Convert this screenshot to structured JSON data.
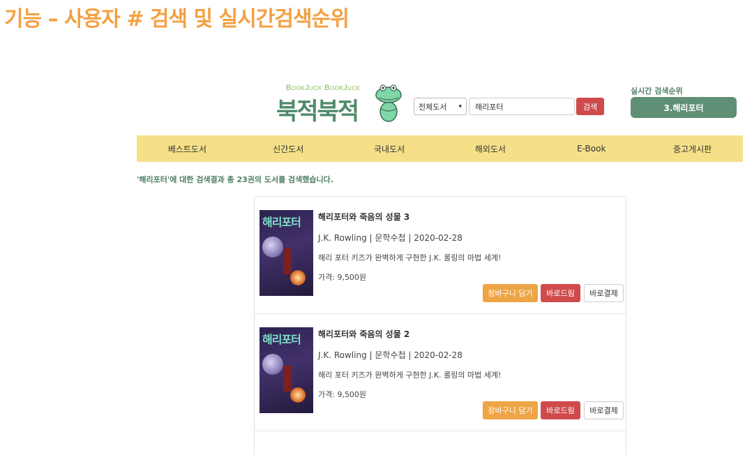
{
  "slide": {
    "title": "기능 – 사용자 # 검색 및 실시간검색순위"
  },
  "header": {
    "logo_sub": "BookJuck BookJuck",
    "logo_main": "북적북적",
    "category_selected": "전체도서",
    "search_value": "해리포터",
    "search_button": "검색",
    "rank_label": "실시간 검색순위",
    "rank_current": "3.해리포터"
  },
  "nav": {
    "items": [
      "베스트도서",
      "신간도서",
      "국내도서",
      "해외도서",
      "E-Book",
      "중고게시판"
    ]
  },
  "result_summary": "'해리포터'에 대한 검색결과 총 23권의 도서를 검색했습니다.",
  "books": [
    {
      "title": "해리포터와 죽음의 성물 3",
      "meta": "J.K. Rowling | 문학수첩 | 2020-02-28",
      "desc": "해리 포터 키즈가 완벽하게 구현한 J.K. 롤링의 마법 세계!",
      "price": "가격: 9,500원",
      "cover_text": "해리포터",
      "btn_cart": "장바구니 담기",
      "btn_gift": "바로드림",
      "btn_buy": "바로결제"
    },
    {
      "title": "해리포터와 죽음의 성물 2",
      "meta": "J.K. Rowling | 문학수첩 | 2020-02-28",
      "desc": "해리 포터 키즈가 완벽하게 구현한 J.K. 롤링의 마법 세계!",
      "price": "가격: 9,500원",
      "cover_text": "해리포터",
      "btn_cart": "장바구니 담기",
      "btn_gift": "바로드림",
      "btn_buy": "바로결제"
    }
  ],
  "colors": {
    "accent_title": "#f4a043",
    "brand_green": "#5f8f75",
    "nav_bg": "#f5e088",
    "btn_red": "#cf4b4b",
    "btn_orange": "#eea546"
  }
}
